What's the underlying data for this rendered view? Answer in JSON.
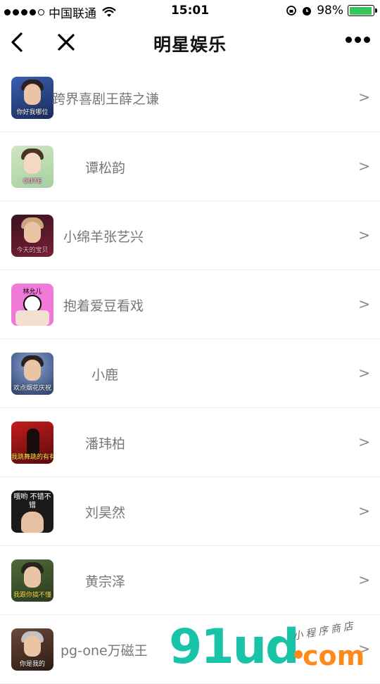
{
  "status_bar": {
    "carrier": "中国联通",
    "time": "15:01",
    "battery": "98%"
  },
  "nav": {
    "title": "明星娱乐"
  },
  "items": [
    {
      "label": "跨界喜剧王薛之谦",
      "caption": "你好我哪位"
    },
    {
      "label": "谭松韵",
      "caption": "CUTE"
    },
    {
      "label": "小绵羊张艺兴",
      "caption": "今天的宝贝"
    },
    {
      "label": "抱着爱豆看戏",
      "caption": "林允儿"
    },
    {
      "label": "小鹿",
      "caption": "欢点烟花庆祝"
    },
    {
      "label": "潘玮柏",
      "caption": "我跳舞跳的有有点"
    },
    {
      "label": "刘昊然",
      "caption": "哦哟 不错不错"
    },
    {
      "label": "黄宗泽",
      "caption": "我跟你搞不懂"
    },
    {
      "label": "pg-one万磁王",
      "caption": "你是我的"
    }
  ],
  "chevron": ">",
  "watermark": {
    "brand": "91ud",
    "domain": "com",
    "tagline": "小程序商店"
  },
  "colors": {
    "accent_green": "#34c759",
    "watermark_teal": "#19c3a7",
    "watermark_orange": "#ff8a1a"
  }
}
